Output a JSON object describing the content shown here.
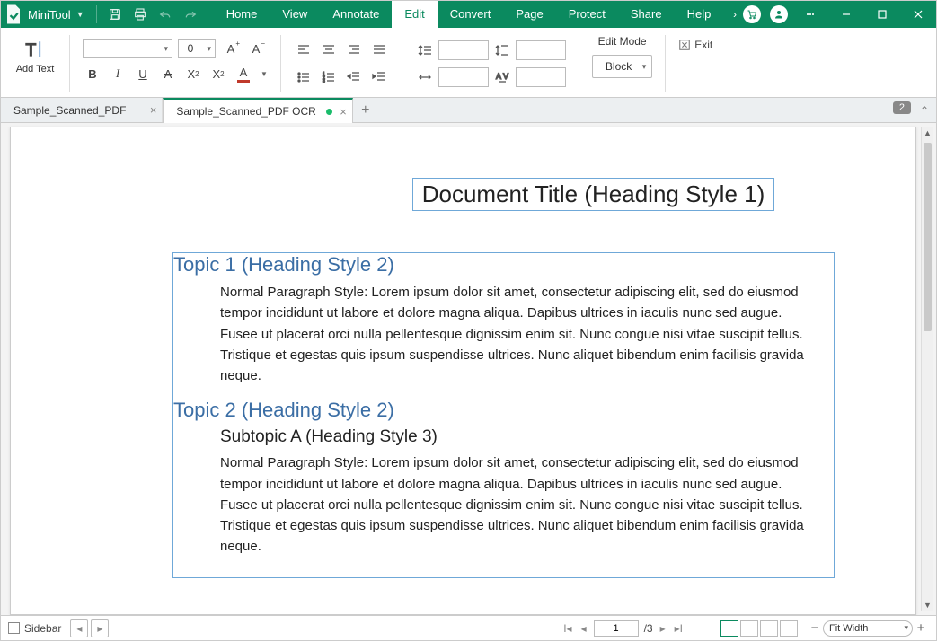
{
  "app": {
    "name": "MiniTool"
  },
  "menus": [
    "Home",
    "View",
    "Annotate",
    "Edit",
    "Convert",
    "Page",
    "Protect",
    "Share",
    "Help"
  ],
  "active_menu": "Edit",
  "ribbon": {
    "add_text": "Add Text",
    "font_size": "0",
    "edit_mode_label": "Edit Mode",
    "block_label": "Block",
    "exit_label": "Exit"
  },
  "tabs": [
    {
      "label": "Sample_Scanned_PDF",
      "active": false,
      "modified": false
    },
    {
      "label": "Sample_Scanned_PDF OCR",
      "active": true,
      "modified": true
    }
  ],
  "page_badge": "2",
  "document": {
    "title": "Document Title (Heading Style 1)",
    "topic1": "Topic 1 (Heading Style 2)",
    "para1": "Normal Paragraph Style: Lorem ipsum dolor sit amet, consectetur adipiscing elit, sed do eiusmod tempor incididunt ut labore et dolore magna aliqua. Dapibus ultrices in iaculis nunc sed augue. Fusee ut placerat orci nulla pellentesque dignissim enim sit. Nunc congue nisi vitae suscipit tellus. Tristique et egestas quis ipsum suspendisse ultrices. Nunc aliquet bibendum enim facilisis gravida neque.",
    "topic2": "Topic 2 (Heading Style 2)",
    "subtopic_a": "Subtopic A (Heading Style 3)",
    "para2": "Normal Paragraph Style: Lorem ipsum dolor sit amet, consectetur adipiscing elit, sed do eiusmod tempor incididunt ut labore et dolore magna aliqua. Dapibus ultrices in iaculis nunc sed augue. Fusee ut placerat orci nulla pellentesque dignissim enim sit. Nunc congue nisi vitae suscipit tellus. Tristique et egestas quis ipsum suspendisse ultrices. Nunc aliquet bibendum enim facilisis gravida neque."
  },
  "status": {
    "sidebar_label": "Sidebar",
    "current_page": "1",
    "total_pages": "/3",
    "zoom_label": "Fit Width"
  }
}
